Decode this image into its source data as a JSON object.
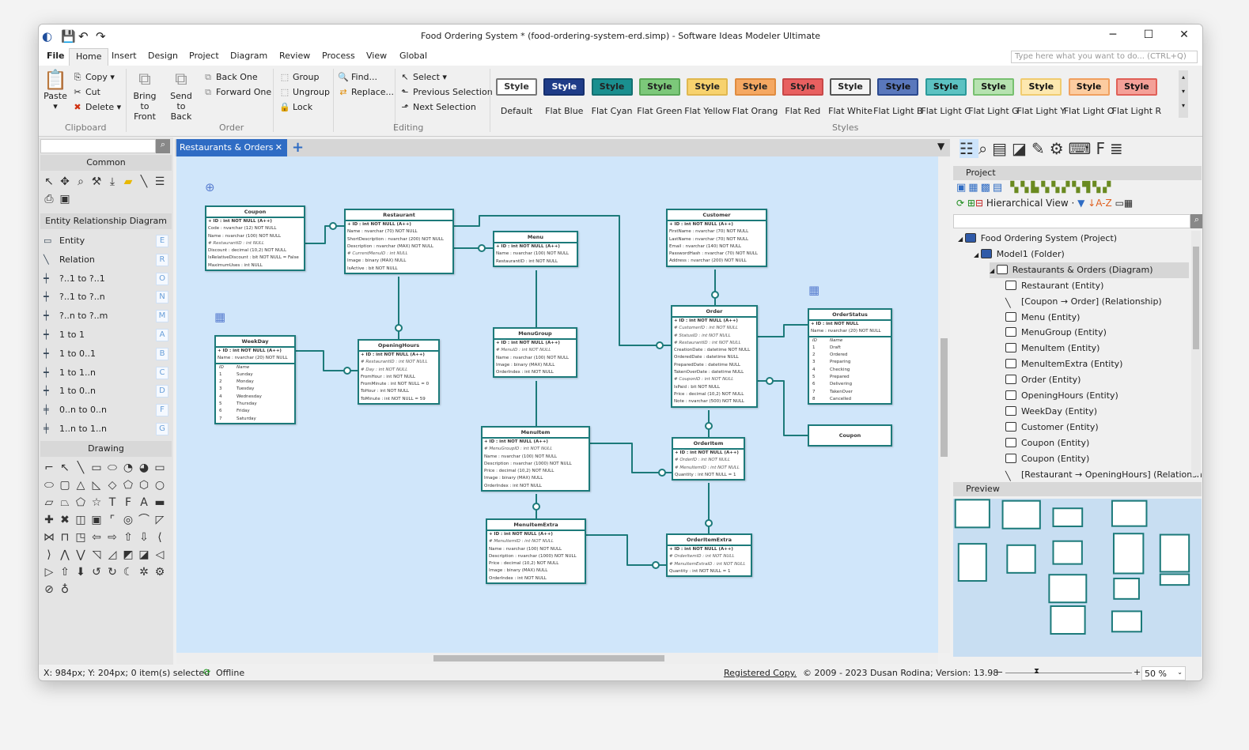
{
  "window": {
    "title": "Food Ordering System * (food-ordering-system-erd.simp) - Software Ideas Modeler Ultimate",
    "minimize": "─",
    "maximize": "☐",
    "close": "✕"
  },
  "menu": {
    "tabs": [
      "File",
      "Home",
      "Insert",
      "Design",
      "Project",
      "Diagram",
      "Review",
      "Process",
      "View",
      "Global"
    ],
    "active": "Home",
    "search_placeholder": "Type here what you want to do... (CTRL+Q)"
  },
  "ribbon": {
    "clipboard": {
      "paste": "Paste",
      "copy": "Copy",
      "cut": "Cut",
      "delete": "Delete",
      "label": "Clipboard"
    },
    "order": {
      "bring_front": "Bring to Front",
      "send_back": "Send to Back",
      "back_one": "Back One",
      "forward_one": "Forward One",
      "label": "Order"
    },
    "group": {
      "group": "Group",
      "ungroup": "Ungroup",
      "lock": "Lock"
    },
    "editing": {
      "find": "Find...",
      "replace": "Replace...",
      "select": "Select",
      "prev": "Previous Selection",
      "next": "Next Selection",
      "label": "Editing"
    },
    "styles": {
      "label": "Styles",
      "button_text": "Style",
      "items": [
        {
          "name": "Default",
          "bg": "#ffffff",
          "border": "#777777",
          "fg": "#333333"
        },
        {
          "name": "Flat Blue",
          "bg": "#1f3c88",
          "border": "#16306e",
          "fg": "#ffffff"
        },
        {
          "name": "Flat Cyan",
          "bg": "#1a8f8f",
          "border": "#147070",
          "fg": "#222222"
        },
        {
          "name": "Flat Green",
          "bg": "#7cc87a",
          "border": "#5aa858",
          "fg": "#222222"
        },
        {
          "name": "Flat Yellow",
          "bg": "#f7d26e",
          "border": "#e0b850",
          "fg": "#222222"
        },
        {
          "name": "Flat Orang",
          "bg": "#f5a862",
          "border": "#e08c40",
          "fg": "#222222"
        },
        {
          "name": "Flat Red",
          "bg": "#e86060",
          "border": "#c84848",
          "fg": "#222222"
        },
        {
          "name": "Flat White",
          "bg": "#f4f4f4",
          "border": "#555555",
          "fg": "#222222"
        },
        {
          "name": "Flat Light B",
          "bg": "#5a78bc",
          "border": "#2c4a90",
          "fg": "#111111"
        },
        {
          "name": "Flat Light C",
          "bg": "#5cc2c2",
          "border": "#2a9a9a",
          "fg": "#111111"
        },
        {
          "name": "Flat Light G",
          "bg": "#b6e2b0",
          "border": "#78c070",
          "fg": "#111111"
        },
        {
          "name": "Flat Light Y",
          "bg": "#fde8b0",
          "border": "#f0cc70",
          "fg": "#111111"
        },
        {
          "name": "Flat Light O",
          "bg": "#fccca0",
          "border": "#f0a060",
          "fg": "#111111"
        },
        {
          "name": "Flat Light R",
          "bg": "#f4a098",
          "border": "#e06058",
          "fg": "#111111"
        }
      ]
    }
  },
  "toolbox": {
    "common": "Common",
    "common_tools": [
      "pointer-icon",
      "move-icon",
      "zoom-icon",
      "format-painter-icon",
      "insert-icon",
      "note-icon",
      "line-icon",
      "list-icon",
      "stamp-icon",
      "frame-icon"
    ],
    "erd_header": "Entity Relationship Diagram",
    "erd_items": [
      {
        "label": "Entity",
        "key": "E"
      },
      {
        "label": "Relation",
        "key": "R"
      },
      {
        "label": "?..1 to ?..1",
        "key": "O"
      },
      {
        "label": "?..1 to ?..n",
        "key": "N"
      },
      {
        "label": "?..n to ?..m",
        "key": "M"
      },
      {
        "label": "1 to 1",
        "key": "A"
      },
      {
        "label": "1 to 0..1",
        "key": "B"
      },
      {
        "label": "1 to 1..n",
        "key": "C"
      },
      {
        "label": "1 to 0..n",
        "key": "D"
      },
      {
        "label": "0..n to 0..n",
        "key": "F"
      },
      {
        "label": "1..n to 1..n",
        "key": "G"
      }
    ],
    "drawing": "Drawing",
    "drawing_glyphs": [
      "⌐",
      "↖",
      "╲",
      "▭",
      "⬭",
      "◔",
      "◕",
      "▭",
      "⬭",
      "▢",
      "△",
      "◺",
      "◇",
      "⬠",
      "⬡",
      "○",
      "▱",
      "⏢",
      "⬠",
      "☆",
      "T",
      "F",
      "A",
      "▬",
      "✚",
      "✖",
      "◫",
      "▣",
      "⌜",
      "◎",
      "⌒",
      "◸",
      "⋈",
      "⊓",
      "◳",
      "⇦",
      "⇨",
      "⇧",
      "⇩",
      "⟨",
      "⟩",
      "⋀",
      "⋁",
      "◹",
      "◿",
      "◩",
      "◪",
      "◁",
      "▷",
      "⇧",
      "⬇",
      "↺",
      "↻",
      "☾",
      "✲",
      "⚙",
      "⊘",
      "♁"
    ]
  },
  "document": {
    "tab": "Restaurants & Orders",
    "close": "✕",
    "add": "+"
  },
  "entities": [
    {
      "name": "Coupon",
      "fields": [
        "+ ID : int NOT NULL  (A++)",
        "Code : nvarchar (12)  NOT NULL",
        "Name : nvarchar (100)  NOT NULL",
        "# RestaurantID : int NULL",
        "Discount : decimal (10,2)  NOT NULL",
        "IsRelativeDiscount : bit NOT NULL = False",
        "MaximumUses : int NULL"
      ]
    },
    {
      "name": "Restaurant",
      "fields": [
        "+ ID : int NOT NULL  (A++)",
        "Name : nvarchar (70)  NOT NULL",
        "ShortDescription : nvarchar (200)  NOT NULL",
        "Description : nvarchar (MAX)  NOT NULL",
        "# CurrentMenuID : int NULL",
        "Image : binary (MAX)  NULL",
        "IsActive : bit NOT NULL"
      ]
    },
    {
      "name": "Menu",
      "fields": [
        "+ ID : int NOT NULL  (A++)",
        "Name : nvarchar (100)  NOT NULL",
        "RestaurantID : int NOT NULL"
      ]
    },
    {
      "name": "Customer",
      "fields": [
        "+ ID : int NOT NULL  (A++)",
        "FirstName : nvarchar (70)  NOT NULL",
        "LastName : nvarchar (70)  NOT NULL",
        "Email : nvarchar (140)  NOT NULL",
        "PasswordHash : nvarchar (70)  NOT NULL",
        "Address : nvarchar (200)  NOT NULL"
      ]
    },
    {
      "name": "WeekDay",
      "fields": [
        "+ ID : int NOT NULL  (A++)",
        "Name : nvarchar (20)  NOT NULL"
      ],
      "rows_header": [
        "ID",
        "Name"
      ],
      "rows": [
        [
          "1",
          "Sunday"
        ],
        [
          "2",
          "Monday"
        ],
        [
          "3",
          "Tuesday"
        ],
        [
          "4",
          "Wednesday"
        ],
        [
          "5",
          "Thursday"
        ],
        [
          "6",
          "Friday"
        ],
        [
          "7",
          "Saturday"
        ]
      ]
    },
    {
      "name": "OpeningHours",
      "fields": [
        "+ ID : int NOT NULL  (A++)",
        "# RestaurantID : int NOT NULL",
        "# Day : int NOT NULL",
        "FromHour : int NOT NULL",
        "FromMinute : int NOT NULL = 0",
        "ToHour : int NOT NULL",
        "ToMinute : int NOT NULL = 59"
      ]
    },
    {
      "name": "MenuGroup",
      "fields": [
        "+ ID : int NOT NULL  (A++)",
        "# MenuID : int NOT NULL",
        "Name : nvarchar (100)  NOT NULL",
        "Image : binary (MAX)  NULL",
        "OrderIndex : int NOT NULL"
      ]
    },
    {
      "name": "Order",
      "fields": [
        "+ ID : int NOT NULL  (A++)",
        "# CustomerID : int NOT NULL",
        "# StatusID : int NOT NULL",
        "# RestaurantID : int NOT NULL",
        "CreationDate : datetime NOT NULL",
        "OrderedDate : datetime NULL",
        "PreparedDate : datetime NULL",
        "TakenOverDate : datetime NULL",
        "# CouponID : int NOT NULL",
        "IsPaid : bit NOT NULL",
        "Price : decimal (10,2)  NOT NULL",
        "Note : nvarchar (500)  NOT NULL"
      ]
    },
    {
      "name": "OrderStatus",
      "fields": [
        "+ ID : int NOT NULL",
        "Name : nvarchar (20)  NOT NULL"
      ],
      "rows_header": [
        "ID",
        "Name"
      ],
      "rows": [
        [
          "1",
          "Draft"
        ],
        [
          "2",
          "Ordered"
        ],
        [
          "3",
          "Preparing"
        ],
        [
          "4",
          "Checking"
        ],
        [
          "5",
          "Prepared"
        ],
        [
          "6",
          "Delivering"
        ],
        [
          "7",
          "TakenOver"
        ],
        [
          "8",
          "Cancelled"
        ]
      ]
    },
    {
      "name": "Coupon",
      "fields": []
    },
    {
      "name": "MenuItem",
      "fields": [
        "+ ID : int NOT NULL  (A++)",
        "# MenuGroupID : int NOT NULL",
        "Name : nvarchar (100)  NOT NULL",
        "Description : nvarchar (1000)  NOT NULL",
        "Price : decimal (10,2)  NOT NULL",
        "Image : binary (MAX)  NULL",
        "OrderIndex : int NOT NULL"
      ]
    },
    {
      "name": "OrderItem",
      "fields": [
        "+ ID : int NOT NULL  (A++)",
        "# OrderID : int NOT NULL",
        "# MenuItemID : int NOT NULL",
        "Quantity : int NOT NULL = 1"
      ]
    },
    {
      "name": "MenuItemExtra",
      "fields": [
        "+ ID : int NOT NULL  (A++)",
        "# MenuItemID : int NOT NULL",
        "Name : nvarchar (100)  NOT NULL",
        "Description : nvarchar (1000)  NOT NULL",
        "Price : decimal (10,2)  NOT NULL",
        "Image : binary (MAX)  NULL",
        "OrderIndex : int NOT NULL"
      ]
    },
    {
      "name": "OrderItemExtra",
      "fields": [
        "+ ID : int NOT NULL  (A++)",
        "# OrderItemID : int NOT NULL",
        "# MenuItemExtraID : int NOT NULL",
        "Quantity : int NOT NULL = 1"
      ]
    }
  ],
  "project": {
    "title": "Project",
    "view": "Hierarchical View",
    "tree": [
      {
        "label": "Food Ordering System (Project)",
        "level": 0
      },
      {
        "label": "Model1 (Folder)",
        "level": 1
      },
      {
        "label": "Restaurants & Orders (Diagram)",
        "level": 2,
        "selected": true
      },
      {
        "label": "Restaurant (Entity)",
        "level": 3
      },
      {
        "label": "[Coupon → Order] (Relationship)",
        "level": 3,
        "rel": true
      },
      {
        "label": "Menu (Entity)",
        "level": 3
      },
      {
        "label": "MenuGroup (Entity)",
        "level": 3
      },
      {
        "label": "MenuItem (Entity)",
        "level": 3
      },
      {
        "label": "MenuItemExtra (Entity)",
        "level": 3
      },
      {
        "label": "Order (Entity)",
        "level": 3
      },
      {
        "label": "OpeningHours (Entity)",
        "level": 3
      },
      {
        "label": "WeekDay (Entity)",
        "level": 3
      },
      {
        "label": "Customer (Entity)",
        "level": 3
      },
      {
        "label": "Coupon (Entity)",
        "level": 3
      },
      {
        "label": "Coupon (Entity)",
        "level": 3
      },
      {
        "label": "[Restaurant → OpeningHours] (Relationshi",
        "level": 3,
        "rel": true
      }
    ]
  },
  "preview": {
    "title": "Preview"
  },
  "status": {
    "coords": "X: 984px; Y: 204px; 0 item(s) selected",
    "offline": "Offline",
    "registered": "Registered Copy.",
    "copyright": "© 2009 - 2023 Dusan Rodina; Version: 13.98",
    "zoom": "50 %",
    "zoom_minus": "−",
    "zoom_plus": "+"
  },
  "colors": {
    "accent": "#2f6cc4",
    "canvas": "#d0e6fa",
    "entity_border": "#1c7a7a"
  }
}
